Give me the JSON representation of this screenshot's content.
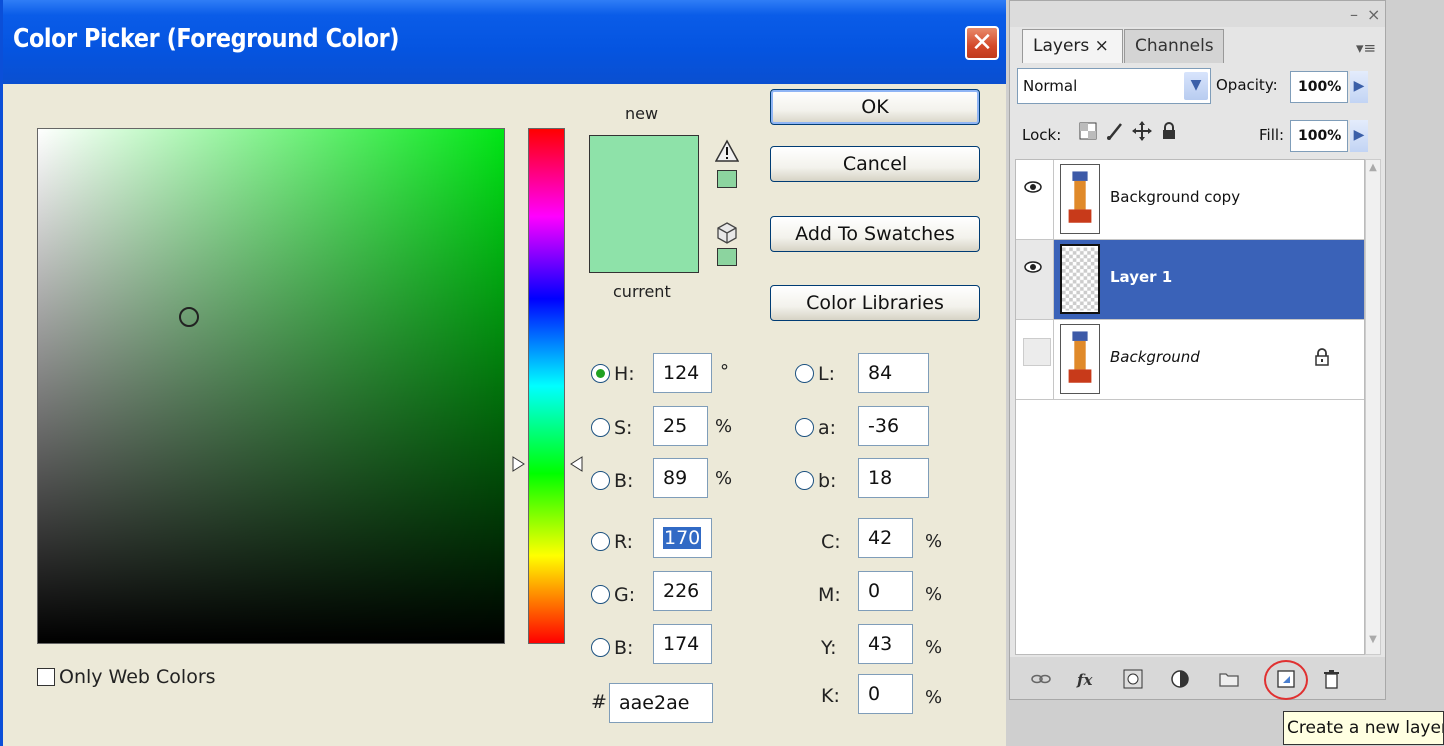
{
  "dialog": {
    "title": "Color Picker (Foreground Color)",
    "close_glyph": "✕",
    "new_label": "new",
    "current_label": "current",
    "new_color": "#8ee2a9",
    "only_web_colors_label": "Only Web Colors",
    "buttons": {
      "ok": "OK",
      "cancel": "Cancel",
      "add_to_swatches": "Add To Swatches",
      "color_libraries": "Color Libraries"
    },
    "hsb": {
      "h": {
        "label": "H:",
        "value": "124",
        "unit": "°",
        "selected": true
      },
      "s": {
        "label": "S:",
        "value": "25",
        "unit": "%"
      },
      "b": {
        "label": "B:",
        "value": "89",
        "unit": "%"
      }
    },
    "rgb": {
      "r": {
        "label": "R:",
        "value": "170"
      },
      "g": {
        "label": "G:",
        "value": "226"
      },
      "b": {
        "label": "B:",
        "value": "174"
      }
    },
    "lab": {
      "l": {
        "label": "L:",
        "value": "84"
      },
      "a": {
        "label": "a:",
        "value": "-36"
      },
      "b": {
        "label": "b:",
        "value": "18"
      }
    },
    "cmyk": {
      "c": {
        "label": "C:",
        "value": "42",
        "unit": "%"
      },
      "m": {
        "label": "M:",
        "value": "0",
        "unit": "%"
      },
      "y": {
        "label": "Y:",
        "value": "43",
        "unit": "%"
      },
      "k": {
        "label": "K:",
        "value": "0",
        "unit": "%"
      }
    },
    "hex": {
      "label": "#",
      "value": "aae2ae"
    }
  },
  "layers_panel": {
    "tabs": [
      {
        "label": "Layers ×"
      },
      {
        "label": "Channels"
      }
    ],
    "blend_mode": "Normal",
    "opacity": {
      "label": "Opacity:",
      "value": "100%"
    },
    "lock_label": "Lock:",
    "fill": {
      "label": "Fill:",
      "value": "100%"
    },
    "layers": [
      {
        "name": "Background copy",
        "visible": true
      },
      {
        "name": "Layer 1",
        "visible": true,
        "selected": true
      },
      {
        "name": "Background",
        "visible": false,
        "locked": true
      }
    ],
    "tooltip": "Create a new layer"
  }
}
